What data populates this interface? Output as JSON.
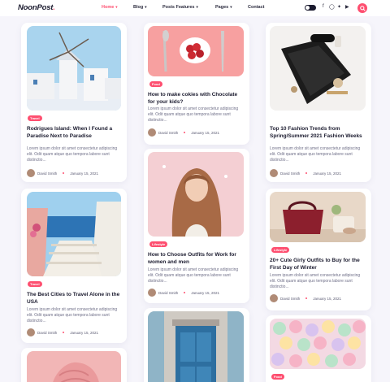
{
  "header": {
    "logo": "NoonPost",
    "nav": [
      "Home",
      "Blog",
      "Posts Features",
      "Pages",
      "Contact"
    ]
  },
  "cards": [
    {
      "category": "Travel",
      "title": "Rodrigues Island: When I Found a Paradise Next to Paradise",
      "excerpt": "Lorem ipsum dolor sit amet consectetur adipiscing elit. Odit quam atque quo tempora labore sunt distinctio...",
      "author": "David Smith",
      "date": "January 15, 2021"
    },
    {
      "category": "Food",
      "title": "How to make cokies with Chocolate for your kids?",
      "excerpt": "Lorem ipsum dolor sit amet consectetur adipiscing elit. Odit quam atque quo tempora labore sunt distinctio...",
      "author": "David Smith",
      "date": "January 15, 2021"
    },
    {
      "category": "",
      "title": "Top 10 Fashion Trends from Spring/Summer 2021 Fashion Weeks",
      "excerpt": "Lorem ipsum dolor sit amet consectetur adipiscing elit. Odit quam atque quo tempora labore sunt distinctio...",
      "author": "David Smith",
      "date": "January 15, 2021"
    },
    {
      "category": "Travel",
      "title": "The Best Cities to Travel Alone in the USA",
      "excerpt": "Lorem ipsum dolor sit amet consectetur adipiscing elit. Odit quam atque quo tempora labore sunt distinctio...",
      "author": "David Smith",
      "date": "January 15, 2021"
    },
    {
      "category": "Lifestyle",
      "title": "How to Choose Outfits for Work for women and men",
      "excerpt": "Lorem ipsum dolor sit amet consectetur adipiscing elit. Odit quam atque quo tempora labore sunt distinctio...",
      "author": "David Smith",
      "date": "January 15, 2021"
    },
    {
      "category": "Lifestyle",
      "title": "20+ Cute Girly Outfits to Buy for the First Day of Winter",
      "excerpt": "Lorem ipsum dolor sit amet consectetur adipiscing elit. Odit quam atque quo tempora labore sunt distinctio...",
      "author": "David Smith",
      "date": "January 15, 2021"
    },
    {
      "category": "Food",
      "title": "",
      "excerpt": "",
      "author": "",
      "date": ""
    }
  ],
  "colors": {
    "accent": "#fe4f70",
    "text": "#1b1b2f",
    "muted": "#707089",
    "background": "#f6f5fb"
  }
}
